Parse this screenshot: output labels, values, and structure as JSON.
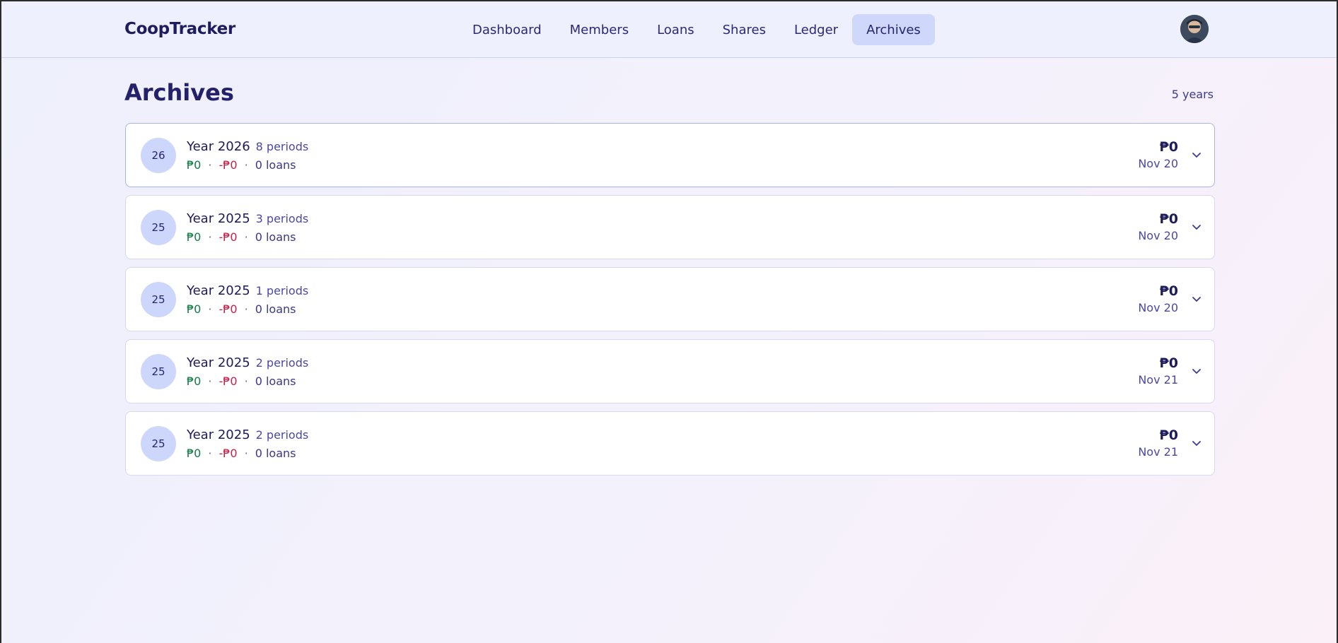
{
  "app": {
    "brand": "CoopTracker"
  },
  "nav": {
    "items": [
      {
        "label": "Dashboard"
      },
      {
        "label": "Members"
      },
      {
        "label": "Loans"
      },
      {
        "label": "Shares"
      },
      {
        "label": "Ledger"
      },
      {
        "label": "Archives",
        "active": true
      }
    ]
  },
  "page": {
    "title": "Archives",
    "count": "5 years"
  },
  "archives": [
    {
      "badge": "26",
      "year": "Year 2026",
      "periods": "8 periods",
      "inflow": "₱0",
      "outflow": "-₱0",
      "loans": "0 loans",
      "total": "₱0",
      "date": "Nov 20"
    },
    {
      "badge": "25",
      "year": "Year 2025",
      "periods": "3 periods",
      "inflow": "₱0",
      "outflow": "-₱0",
      "loans": "0 loans",
      "total": "₱0",
      "date": "Nov 20"
    },
    {
      "badge": "25",
      "year": "Year 2025",
      "periods": "1 periods",
      "inflow": "₱0",
      "outflow": "-₱0",
      "loans": "0 loans",
      "total": "₱0",
      "date": "Nov 20"
    },
    {
      "badge": "25",
      "year": "Year 2025",
      "periods": "2 periods",
      "inflow": "₱0",
      "outflow": "-₱0",
      "loans": "0 loans",
      "total": "₱0",
      "date": "Nov 21"
    },
    {
      "badge": "25",
      "year": "Year 2025",
      "periods": "2 periods",
      "inflow": "₱0",
      "outflow": "-₱0",
      "loans": "0 loans",
      "total": "₱0",
      "date": "Nov 21"
    }
  ],
  "icons": {
    "expand": "chevron-down-icon",
    "avatar": "user-avatar"
  },
  "colors": {
    "accent": "#cfd8fb",
    "positive": "#127a45",
    "negative": "#c2234a",
    "text": "#1e1b5a"
  }
}
